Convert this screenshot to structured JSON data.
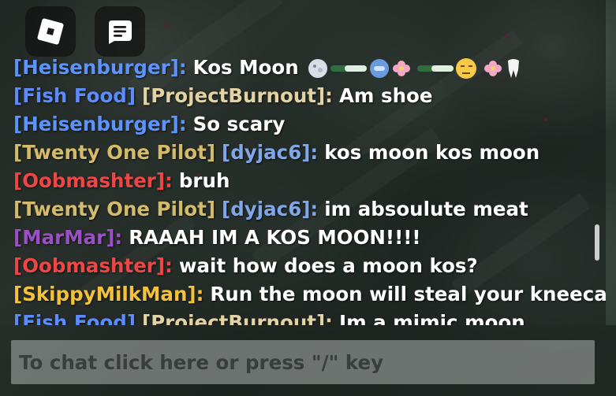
{
  "top_bar": {
    "roblox_menu_icon": "roblox-logo-icon",
    "chat_toggle_icon": "chat-bubble-icon"
  },
  "chat": {
    "messages": [
      {
        "parts": [
          {
            "text": "[Heisenburger]:",
            "color": "#5b93ff"
          },
          {
            "text": "Kos Moon",
            "color": "#ffffff"
          }
        ],
        "emojis": "moon-face, pill, bubble, flower, pill, slightly-smiling-face, flower, tooth"
      },
      {
        "parts": [
          {
            "text": "[Fish Food]",
            "color": "#5b8cff"
          },
          {
            "text": "[ProjectBurnout]:",
            "color": "#e3d2a2"
          },
          {
            "text": "Am shoe",
            "color": "#ffffff"
          }
        ]
      },
      {
        "parts": [
          {
            "text": "[Heisenburger]:",
            "color": "#5b93ff"
          },
          {
            "text": "So scary",
            "color": "#ffffff"
          }
        ]
      },
      {
        "parts": [
          {
            "text": "[Twenty One Pilot]",
            "color": "#d4bb6b"
          },
          {
            "text": "[dyjac6]:",
            "color": "#7ea6e8"
          },
          {
            "text": "kos moon kos moon",
            "color": "#ffffff"
          }
        ]
      },
      {
        "parts": [
          {
            "text": "[Oobmashter]:",
            "color": "#f04545"
          },
          {
            "text": "bruh",
            "color": "#ffffff"
          }
        ]
      },
      {
        "parts": [
          {
            "text": "[Twenty One Pilot]",
            "color": "#d4bb6b"
          },
          {
            "text": "[dyjac6]:",
            "color": "#7ea6e8"
          },
          {
            "text": "im absoulute meat",
            "color": "#ffffff"
          }
        ]
      },
      {
        "parts": [
          {
            "text": "[MarMar]:",
            "color": "#9a4fc6"
          },
          {
            "text": "RAAAH IM A KOS MOON!!!!",
            "color": "#ffffff"
          }
        ]
      },
      {
        "parts": [
          {
            "text": "[Oobmashter]:",
            "color": "#f04545"
          },
          {
            "text": "wait how does a moon kos?",
            "color": "#ffffff"
          }
        ]
      },
      {
        "parts": [
          {
            "text": "[SkippyMilkMan]:",
            "color": "#f3c13a"
          },
          {
            "text": "Run the moon will steal your kneecaps",
            "color": "#ffffff"
          }
        ]
      },
      {
        "parts": [
          {
            "text": "[Fish Food]",
            "color": "#5b8cff"
          },
          {
            "text": "[ProjectBurnout]:",
            "color": "#e3d2a2"
          },
          {
            "text": "Im a mimic moon",
            "color": "#ffffff"
          }
        ]
      }
    ],
    "scroll_position_fraction": 0.72
  },
  "chat_input": {
    "placeholder": "To chat click here or press \"/\" key"
  }
}
